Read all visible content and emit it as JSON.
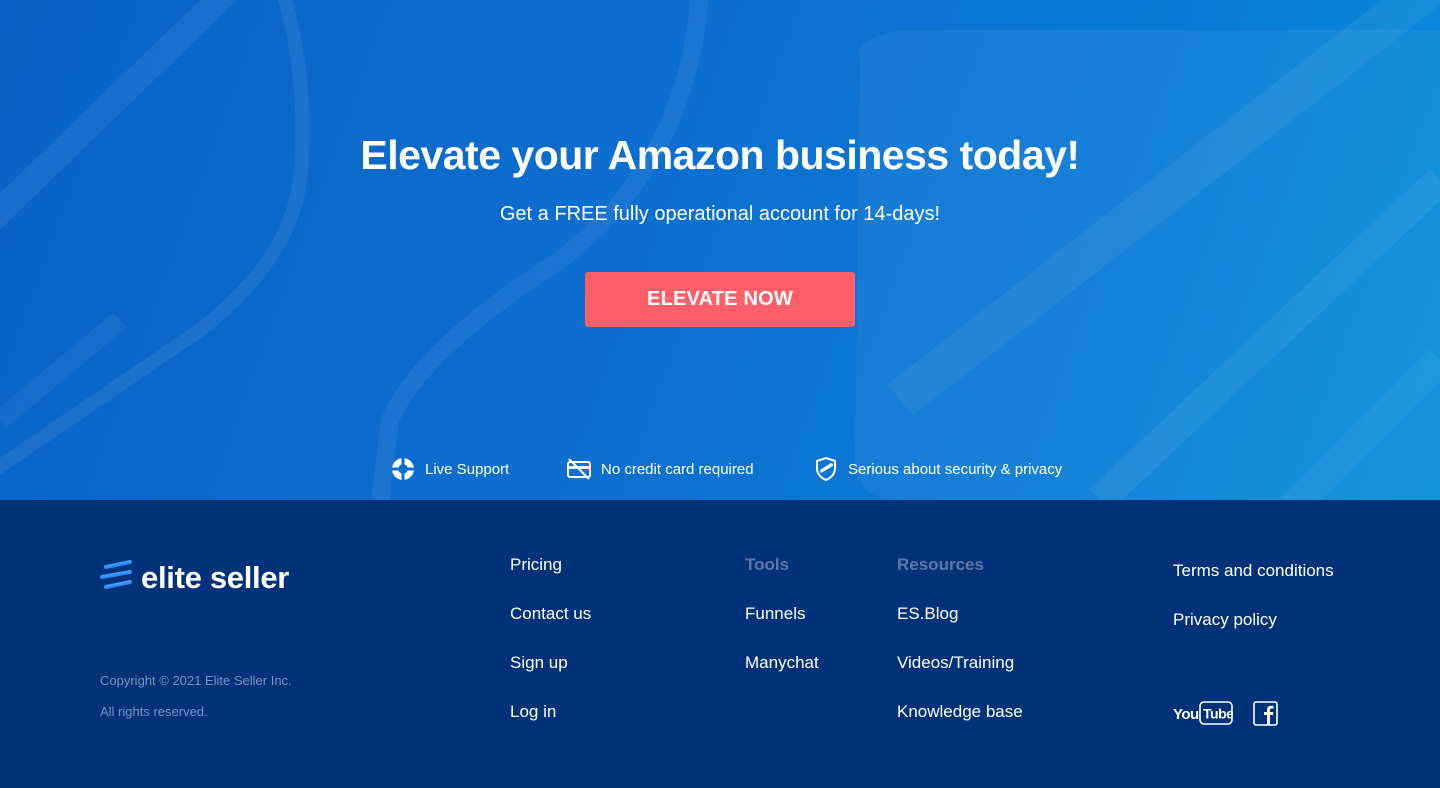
{
  "hero": {
    "headline": "Elevate your Amazon business today!",
    "subline": "Get a FREE fully operational account for 14-days!",
    "cta_label": "ELEVATE NOW",
    "features": [
      {
        "icon": "lifebuoy-icon",
        "label": "Live Support"
      },
      {
        "icon": "no-credit-card-icon",
        "label": "No credit card required"
      },
      {
        "icon": "shield-icon",
        "label": "Serious about security & privacy"
      }
    ]
  },
  "footer": {
    "brand": "elite seller",
    "copyright": "Copyright © 2021 Elite Seller Inc.",
    "rights": "All rights reserved.",
    "col_main": [
      "Pricing",
      "Contact us",
      "Sign up",
      "Log in"
    ],
    "tools": {
      "heading": "Tools",
      "items": [
        "Funnels",
        "Manychat"
      ]
    },
    "resources": {
      "heading": "Resources",
      "items": [
        "ES.Blog",
        "Videos/Training",
        "Knowledge base"
      ]
    },
    "legal": [
      "Terms and conditions",
      "Privacy policy"
    ],
    "social": [
      {
        "icon": "youtube-icon",
        "label": "YouTube"
      },
      {
        "icon": "facebook-icon",
        "label": "Facebook"
      }
    ]
  },
  "colors": {
    "hero_blue": "#0c6fd0",
    "cta": "#fe5f68",
    "footer_bg": "#00327a",
    "muted_heading": "#5f77a6",
    "copyright": "#7c93bc"
  }
}
